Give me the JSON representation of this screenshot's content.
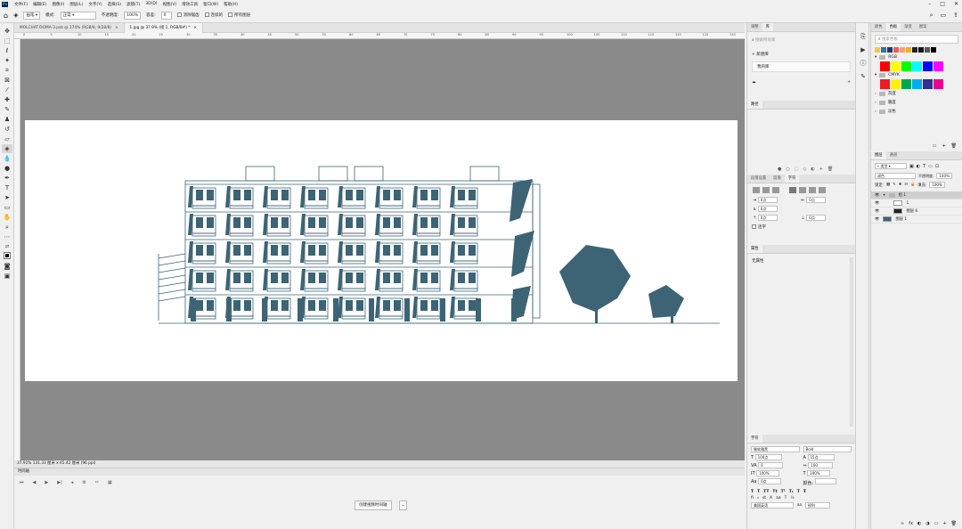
{
  "menu": {
    "logo": "Ps",
    "items": [
      "文件(F)",
      "编辑(E)",
      "图像(I)",
      "图层(L)",
      "文字(Y)",
      "选择(S)",
      "滤镜(T)",
      "3D(D)",
      "视图(V)",
      "增效工具",
      "窗口(W)",
      "帮助(H)"
    ]
  },
  "options_bar": {
    "brush_label": "画笔",
    "mode_label": "模式:",
    "mode_value": "正常",
    "opacity_label": "不透明度:",
    "opacity_value": "100%",
    "tolerance_label": "容差:",
    "tolerance_value": "0",
    "antialias_label": "消除锯齿",
    "contiguous_label": "连续的",
    "all_layers_label": "所有图层"
  },
  "tabs": [
    {
      "label": "MOLCHAT DOMA-3.psb @ 174% (RGB/8, 9/28/8)",
      "active": false
    },
    {
      "label": "1.jpg @ 37.9% (组 1, RGB/8#) *",
      "active": true
    }
  ],
  "ruler_ticks": [
    "0",
    "5",
    "10",
    "15",
    "20",
    "25",
    "30",
    "35",
    "40",
    "45",
    "50",
    "55",
    "60",
    "65",
    "70",
    "75",
    "80",
    "85",
    "90",
    "95",
    "100",
    "105",
    "110",
    "115",
    "120",
    "125",
    "130"
  ],
  "status": "37.91%    131.33 厘米 x 45.42 厘米 (96 ppi)",
  "timeline": {
    "title": "时间轴",
    "create_button": "创建视频时间轴"
  },
  "panels": {
    "properties": {
      "tabs": [
        "调整",
        "库"
      ],
      "search_placeholder": "搜索所有库",
      "new_library": "新建库",
      "my_library": "我的库"
    },
    "paths": {
      "title": "路径"
    },
    "paragraph": {
      "tabs": [
        "段落设置",
        "段落",
        "字符"
      ],
      "fields": [
        "0点",
        "0点",
        "0点",
        "0点",
        "0点"
      ],
      "hyphen_label": "连字"
    },
    "history": {
      "title": "属性",
      "empty_label": "无属性"
    },
    "character": {
      "title": "字符",
      "font": "微软雅黑",
      "style": "Bold",
      "size": "100点",
      "leading": "15点",
      "tracking": "0",
      "kerning": "100",
      "scale_v": "100%",
      "scale_h": "100%",
      "baseline": "0点",
      "color_label": "颜色:",
      "language": "美国英语",
      "aa": "锐利"
    },
    "swatches": {
      "tabs": [
        "颜色",
        "色板",
        "渐变",
        "图案"
      ],
      "search_placeholder": "搜索色板",
      "groups": [
        "RGB",
        "CMYK",
        "灰度",
        "暖度",
        "淡色"
      ],
      "recent_colors": [
        "#f2c94c",
        "#3a6ea5",
        "#1f3a5f",
        "#f25c54",
        "#f7a072",
        "#e6b422",
        "#222222",
        "#111111",
        "#555555",
        "#000000"
      ],
      "rgb_colors": [
        "#ff0000",
        "#ffff00",
        "#00ff00",
        "#00ffff",
        "#0000ff",
        "#ff00ff"
      ],
      "cmyk_colors": [
        "#ed1c24",
        "#fff200",
        "#00a651",
        "#00aeef",
        "#2e3192",
        "#ec008c"
      ]
    },
    "layers": {
      "tabs": [
        "图层",
        "通道"
      ],
      "filter_label": "类型",
      "blend_mode": "滤色",
      "opacity_label": "不透明度:",
      "opacity_value": "100%",
      "lock_label": "锁定:",
      "fill_label": "填充:",
      "fill_value": "100%",
      "items": [
        {
          "name": "组 1",
          "selected": true
        },
        {
          "name": "1",
          "selected": false
        },
        {
          "name": "图层 6",
          "selected": false
        },
        {
          "name": "图层 1",
          "selected": false
        }
      ]
    }
  },
  "colors": {
    "building": "#3d6475",
    "workspace": "#8a8a8a"
  }
}
